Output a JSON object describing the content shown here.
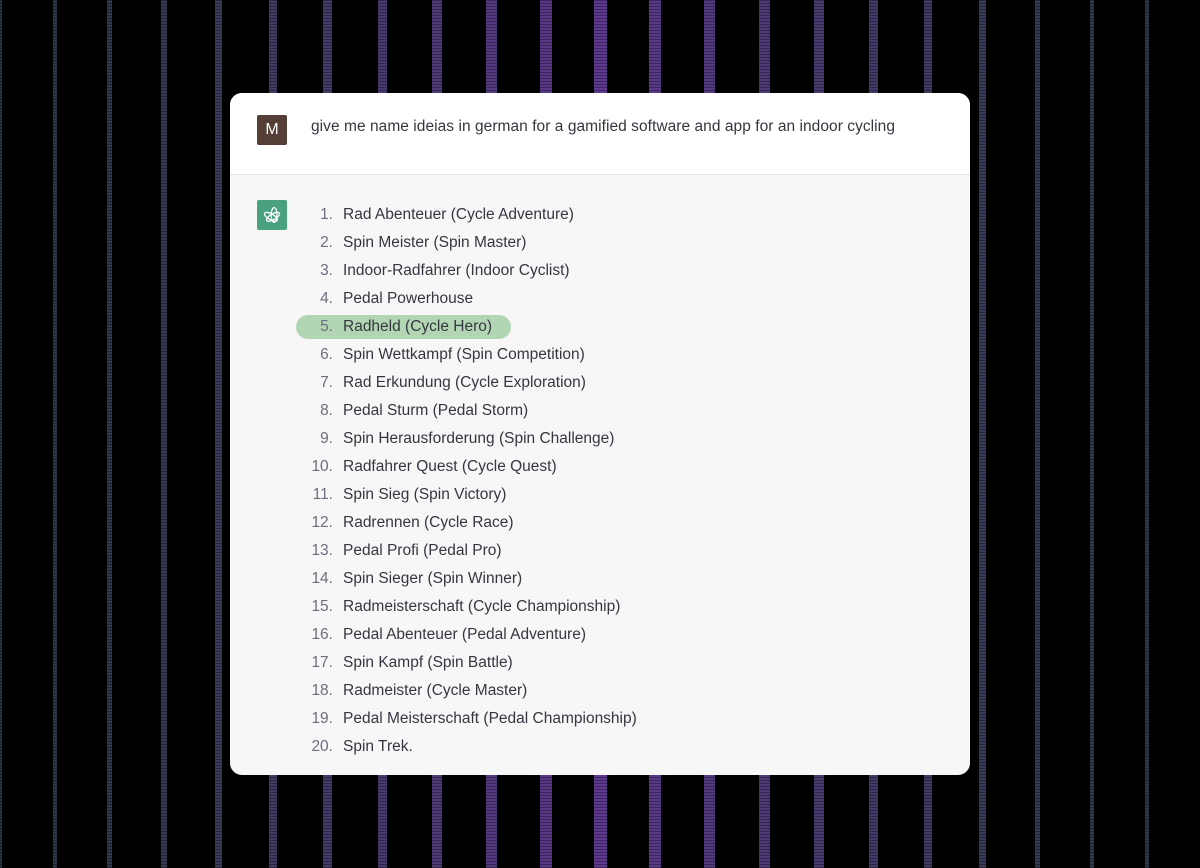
{
  "background": {
    "base_color": "#000000",
    "stripe_edge_color": "#4a6378",
    "stripe_center_color": "#6a3fa0"
  },
  "conversation": {
    "user": {
      "avatar_letter": "M",
      "avatar_color": "#553e36",
      "message": "give me name ideias in german for a gamified software and app for an indoor cycling"
    },
    "assistant": {
      "logo_icon": "openai-logo-icon",
      "logo_color": "#4aa17f",
      "highlight_color": "#b2d6b4",
      "highlighted_index": 5,
      "items": [
        {
          "n": "1.",
          "text": "Rad Abenteuer (Cycle Adventure)"
        },
        {
          "n": "2.",
          "text": "Spin Meister (Spin Master)"
        },
        {
          "n": "3.",
          "text": "Indoor-Radfahrer (Indoor Cyclist)"
        },
        {
          "n": "4.",
          "text": "Pedal Powerhouse"
        },
        {
          "n": "5.",
          "text": "Radheld (Cycle Hero)"
        },
        {
          "n": "6.",
          "text": "Spin Wettkampf (Spin Competition)"
        },
        {
          "n": "7.",
          "text": "Rad Erkundung (Cycle Exploration)"
        },
        {
          "n": "8.",
          "text": "Pedal Sturm (Pedal Storm)"
        },
        {
          "n": "9.",
          "text": "Spin Herausforderung (Spin Challenge)"
        },
        {
          "n": "10.",
          "text": "Radfahrer Quest (Cycle Quest)"
        },
        {
          "n": "11.",
          "text": "Spin Sieg (Spin Victory)"
        },
        {
          "n": "12.",
          "text": "Radrennen (Cycle Race)"
        },
        {
          "n": "13.",
          "text": "Pedal Profi (Pedal Pro)"
        },
        {
          "n": "14.",
          "text": "Spin Sieger (Spin Winner)"
        },
        {
          "n": "15.",
          "text": "Radmeisterschaft (Cycle Championship)"
        },
        {
          "n": "16.",
          "text": "Pedal Abenteuer (Pedal Adventure)"
        },
        {
          "n": "17.",
          "text": "Spin Kampf (Spin Battle)"
        },
        {
          "n": "18.",
          "text": "Radmeister (Cycle Master)"
        },
        {
          "n": "19.",
          "text": "Pedal Meisterschaft (Pedal Championship)"
        },
        {
          "n": "20.",
          "text": "Spin Trek."
        }
      ]
    }
  }
}
